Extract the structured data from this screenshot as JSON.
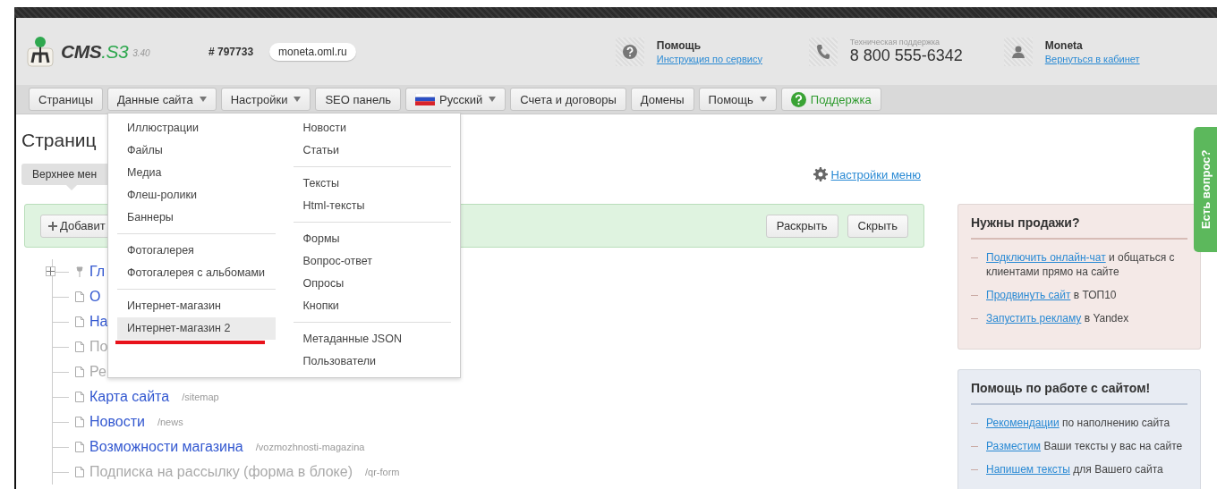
{
  "header": {
    "logo": {
      "name": "CMS",
      "suffix": ".S3",
      "version": "3.40"
    },
    "site_id": "# 797733",
    "domain": "moneta.oml.ru",
    "help": {
      "title": "Помощь",
      "link": "Инструкция по сервису"
    },
    "support": {
      "label": "Техническая поддержка",
      "phone": "8 800 555-6342"
    },
    "user": {
      "name": "Moneta",
      "link": "Вернуться в кабинет"
    }
  },
  "nav": [
    {
      "label": "Страницы",
      "kind": "plain",
      "has_menu": false
    },
    {
      "label": "Данные сайта",
      "kind": "plain",
      "has_menu": true
    },
    {
      "label": "Настройки",
      "kind": "plain",
      "has_menu": true
    },
    {
      "label": "SEO панель",
      "kind": "plain",
      "has_menu": false
    },
    {
      "label": "Русский",
      "kind": "flag",
      "has_menu": true
    },
    {
      "label": "Счета и договоры",
      "kind": "plain",
      "has_menu": false
    },
    {
      "label": "Домены",
      "kind": "plain",
      "has_menu": false
    },
    {
      "label": "Помощь",
      "kind": "plain",
      "has_menu": true
    },
    {
      "label": "Поддержка",
      "kind": "support",
      "has_menu": false
    }
  ],
  "page": {
    "title": "Страниц",
    "tab": {
      "label": "Верхнее мен",
      "selected": true
    },
    "menu_settings": "Настройки меню",
    "add_button": "Добавит",
    "expand_button": "Раскрыть",
    "collapse_button": "Скрыть"
  },
  "tree": [
    {
      "kind": "home",
      "label": "Гл",
      "disabled": false,
      "expanded": false
    },
    {
      "kind": "page",
      "label": "О",
      "disabled": false
    },
    {
      "kind": "page",
      "label": "На",
      "disabled": false
    },
    {
      "kind": "page",
      "label": "По",
      "disabled": true
    },
    {
      "kind": "page",
      "label": "Ре",
      "disabled": true
    },
    {
      "kind": "page",
      "label": "Карта сайта",
      "slug": "/sitemap",
      "disabled": false
    },
    {
      "kind": "page",
      "label": "Новости",
      "slug": "/news",
      "disabled": false
    },
    {
      "kind": "page",
      "label": "Возможности магазина",
      "slug": "/vozmozhnosti-magazina",
      "disabled": false
    },
    {
      "kind": "page",
      "label": "Подписка на рассылку (форма в блоке)",
      "slug": "/qr-form",
      "disabled": true
    }
  ],
  "dropdown": {
    "columns": [
      [
        [
          {
            "label": "Иллюстрации",
            "selected": false
          },
          {
            "label": "Файлы",
            "selected": false
          },
          {
            "label": "Медиа",
            "selected": false
          },
          {
            "label": "Флеш-ролики",
            "selected": false
          },
          {
            "label": "Баннеры",
            "selected": false
          }
        ],
        [
          {
            "label": "Фотогалерея",
            "selected": false
          },
          {
            "label": "Фотогалерея с альбомами",
            "selected": false
          }
        ],
        [
          {
            "label": "Интернет-магазин",
            "selected": false
          },
          {
            "label": "Интернет-магазин 2",
            "selected": true
          }
        ]
      ],
      [
        [
          {
            "label": "Новости",
            "selected": false
          },
          {
            "label": "Статьи",
            "selected": false
          }
        ],
        [
          {
            "label": "Тексты",
            "selected": false
          },
          {
            "label": "Html-тексты",
            "selected": false
          }
        ],
        [
          {
            "label": "Формы",
            "selected": false
          },
          {
            "label": "Вопрос-ответ",
            "selected": false
          },
          {
            "label": "Опросы",
            "selected": false
          },
          {
            "label": "Кнопки",
            "selected": false
          }
        ],
        [
          {
            "label": "Метаданные JSON",
            "selected": false
          },
          {
            "label": "Пользователи",
            "selected": false
          }
        ]
      ]
    ]
  },
  "sidebar": [
    {
      "title": "Нужны продажи?",
      "color": "#f4e9e7",
      "items": [
        {
          "link": "Подключить онлайн-чат",
          "text": "и общаться с клиентами прямо на сайте"
        },
        {
          "link": "Продвинуть сайт",
          "text": "в ТОП10"
        },
        {
          "link": "Запустить рекламу",
          "text": "в Yandex"
        }
      ]
    },
    {
      "title": "Помощь по работе с сайтом!",
      "color": "#e8ecf3",
      "items": [
        {
          "link": "Рекомендации",
          "text": "по наполнению сайта"
        },
        {
          "link": "Разместим",
          "text": "Ваши тексты у вас на сайте"
        },
        {
          "link": "Напишем тексты",
          "text": "для Вашего сайта"
        }
      ]
    }
  ],
  "feedback_tab": "Есть вопрос?"
}
